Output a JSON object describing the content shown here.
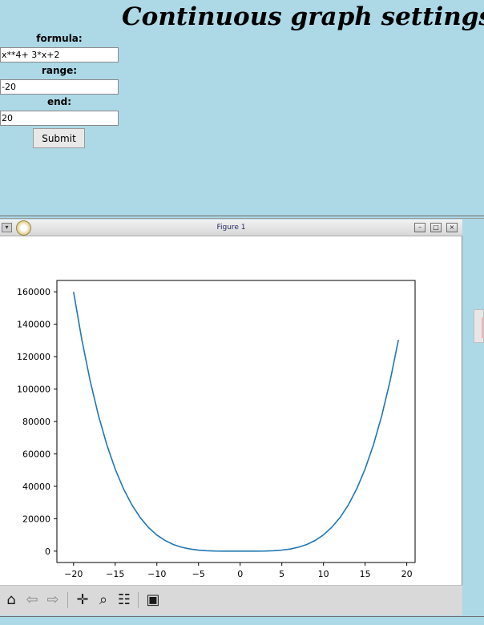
{
  "app": {
    "title": "Continuous graph settings"
  },
  "form": {
    "formula_label": "formula:",
    "formula_value": "x**4+ 3*x+2",
    "range_label": "range:",
    "range_value": "-20",
    "end_label": "end:",
    "end_value": "20",
    "submit_label": "Submit"
  },
  "figure_window": {
    "title": "Figure 1",
    "menu_icon": "window-menu-icon",
    "app_icon": "matplotlib-logo-icon",
    "controls": [
      "minimize-icon",
      "maximize-icon",
      "close-icon"
    ]
  },
  "toolbar": {
    "tools": [
      {
        "name": "home-icon",
        "glyph": "⌂"
      },
      {
        "name": "back-arrow-icon",
        "glyph": "⇦"
      },
      {
        "name": "forward-arrow-icon",
        "glyph": "⇨"
      },
      {
        "name": "pan-icon",
        "glyph": "✛"
      },
      {
        "name": "zoom-icon",
        "glyph": "⌕"
      },
      {
        "name": "configure-subplots-icon",
        "glyph": "☷"
      },
      {
        "name": "save-icon",
        "glyph": "▣"
      }
    ]
  },
  "chart_data": {
    "type": "line",
    "title": "",
    "xlabel": "",
    "ylabel": "",
    "xlim": [
      -22,
      21
    ],
    "ylim": [
      -7000,
      167000
    ],
    "xticks": [
      -20,
      -15,
      -10,
      -5,
      0,
      5,
      10,
      15,
      20
    ],
    "xtick_labels": [
      "−20",
      "−15",
      "−10",
      "−5",
      "0",
      "5",
      "10",
      "15",
      "20"
    ],
    "yticks": [
      0,
      20000,
      40000,
      60000,
      80000,
      100000,
      120000,
      140000,
      160000
    ],
    "ytick_labels": [
      "0",
      "20000",
      "40000",
      "60000",
      "80000",
      "100000",
      "120000",
      "140000",
      "160000"
    ],
    "grid": false,
    "line_color": "#1f77b4",
    "series": [
      {
        "x": [
          -20,
          -19,
          -18,
          -17,
          -16,
          -15,
          -14,
          -13,
          -12,
          -11,
          -10,
          -9,
          -8,
          -7,
          -6,
          -5,
          -4,
          -3,
          -2,
          -1,
          0,
          1,
          2,
          3,
          4,
          5,
          6,
          7,
          8,
          9,
          10,
          11,
          12,
          13,
          14,
          15,
          16,
          17,
          18,
          19
        ],
        "values": [
          159942,
          130267,
          104924,
          83473,
          65490,
          50582,
          38376,
          28523,
          20702,
          14610,
          9972,
          6536,
          4074,
          2383,
          1280,
          612,
          246,
          74,
          12,
          0,
          2,
          6,
          24,
          92,
          270,
          642,
          1316,
          2424,
          4122,
          6590,
          10032,
          14676,
          20774,
          28602,
          38460,
          50672,
          65586,
          83575,
          105032,
          130381
        ]
      }
    ]
  }
}
